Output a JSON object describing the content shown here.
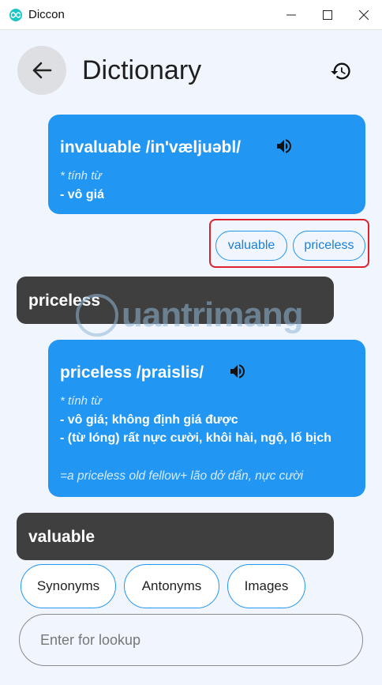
{
  "window": {
    "title": "Diccon"
  },
  "header": {
    "title": "Dictionary"
  },
  "entries": [
    {
      "headword": "invaluable /in'væljuəbl/",
      "part_of_speech": "*  tính từ",
      "definitions": [
        "- vô giá"
      ],
      "example": "",
      "related": [
        "valuable",
        "priceless"
      ]
    },
    {
      "query": "priceless",
      "headword": "priceless /praislis/",
      "part_of_speech": "*  tính từ",
      "definitions": [
        "- vô giá; không định giá được",
        "- (từ lóng) rất nực cười, khôi hài, ngộ, lố bịch"
      ],
      "example": "=a priceless old fellow+ lão dở dẩn, nực cười"
    }
  ],
  "current_query": "valuable",
  "watermark": "uantrimang",
  "tabs": {
    "synonyms": "Synonyms",
    "antonyms": "Antonyms",
    "images": "Images"
  },
  "search": {
    "placeholder": "Enter for lookup",
    "value": ""
  },
  "colors": {
    "accent": "#2196f3",
    "card_dark": "#3f3f3f",
    "highlight": "#e0202d",
    "background": "#f1f5fd"
  }
}
